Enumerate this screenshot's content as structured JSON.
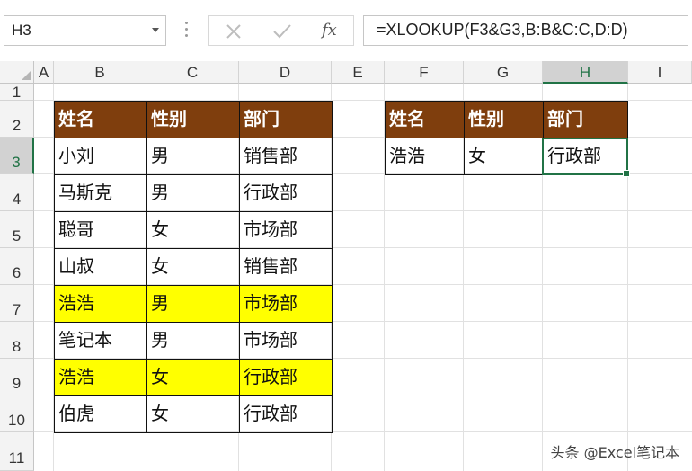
{
  "name_box": {
    "value": "H3"
  },
  "formula_bar": {
    "cancel_icon": "close-icon",
    "enter_icon": "check-icon",
    "fx_label": "fx",
    "formula": "=XLOOKUP(F3&G3,B:B&C:C,D:D)"
  },
  "columns": [
    "A",
    "B",
    "C",
    "D",
    "E",
    "F",
    "G",
    "H",
    "I"
  ],
  "rows": [
    "1",
    "2",
    "3",
    "4",
    "5",
    "6",
    "7",
    "8",
    "9",
    "10",
    "11"
  ],
  "selected_cell": {
    "column": "H",
    "row": "3"
  },
  "source_table": {
    "headers": [
      "姓名",
      "性别",
      "部门"
    ],
    "rows": [
      [
        "小刘",
        "男",
        "销售部"
      ],
      [
        "马斯克",
        "男",
        "行政部"
      ],
      [
        "聪哥",
        "女",
        "市场部"
      ],
      [
        "山叔",
        "女",
        "销售部"
      ],
      [
        "浩浩",
        "男",
        "市场部"
      ],
      [
        "笔记本",
        "男",
        "市场部"
      ],
      [
        "浩浩",
        "女",
        "行政部"
      ],
      [
        "伯虎",
        "女",
        "行政部"
      ]
    ],
    "highlighted_rows": [
      4,
      6
    ],
    "header_color": "#7f3e0d",
    "highlight_color": "#ffff00"
  },
  "lookup_table": {
    "headers": [
      "姓名",
      "性别",
      "部门"
    ],
    "row": [
      "浩浩",
      "女",
      "行政部"
    ]
  },
  "watermark": "头条 @Excel笔记本",
  "accent_color": "#217346"
}
